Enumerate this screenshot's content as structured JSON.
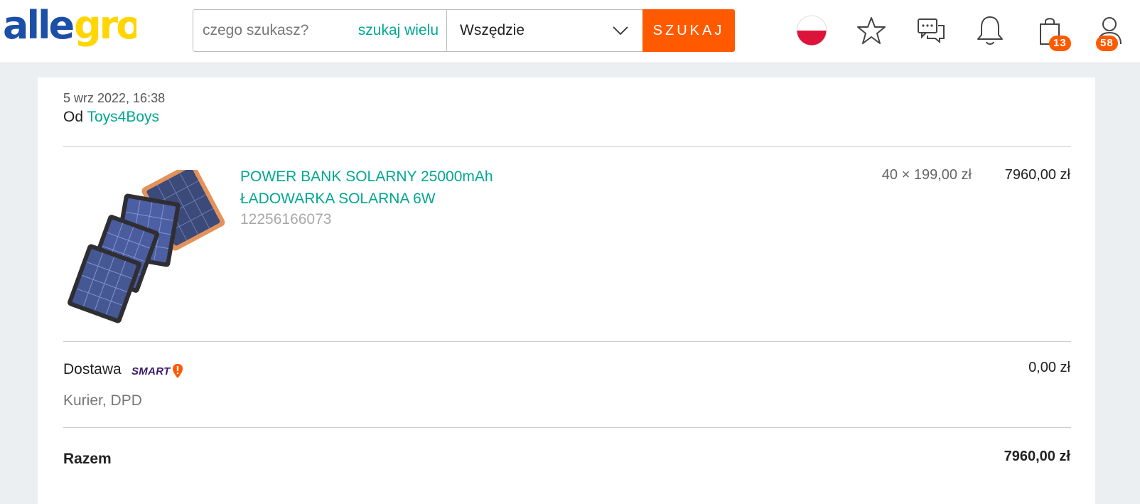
{
  "header": {
    "logo_text": "allegro",
    "search": {
      "placeholder": "czego szukasz?",
      "value": "",
      "many_label": "szukaj wielu",
      "scope_value": "Wszędzie",
      "button_label": "SZUKAJ"
    },
    "icons": [
      "poland-flag-icon",
      "star-icon",
      "chat-icon",
      "bell-icon",
      "shopping-bag-icon",
      "user-icon"
    ],
    "cart_badge": "13",
    "account_badge": "58",
    "accent_color": "#ff5a00"
  },
  "order": {
    "date": "5 wrz 2022, 16:38",
    "from_label": "Od",
    "seller": "Toys4Boys",
    "item": {
      "title": "POWER BANK SOLARNY 25000mAh ŁADOWARKA SOLARNA 6W",
      "offer_id": "12256166073",
      "quantity_price": "40 × 199,00 zł",
      "total": "7960,00 zł"
    },
    "delivery": {
      "label": "Dostawa",
      "badge": "SMART",
      "method": "Kurier, DPD",
      "price": "0,00 zł"
    },
    "summary": {
      "label": "Razem",
      "total": "7960,00 zł"
    }
  },
  "colors": {
    "link": "#00a790",
    "button": "#ff5a00",
    "smart_text": "#3c1a6e"
  }
}
